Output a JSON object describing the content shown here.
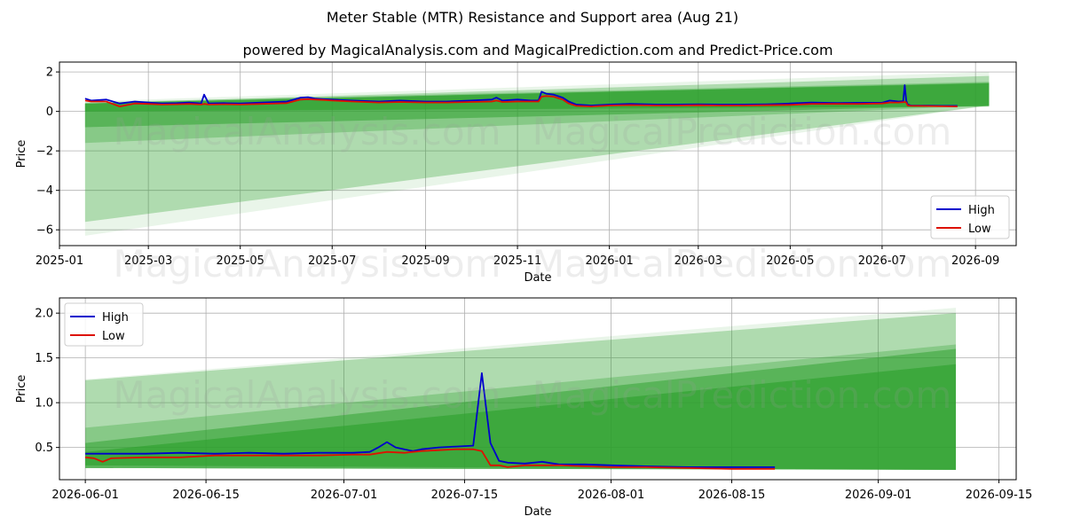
{
  "title": "Meter Stable (MTR) Resistance and Support area (Aug 21)",
  "subtitle": "powered by MagicalAnalysis.com and MagicalPrediction.com and Predict-Price.com",
  "watermarks": [
    "MagicalAnalysis.com",
    "MagicalPrediction.com"
  ],
  "colors": {
    "high": "#0000cc",
    "low": "#dd1100",
    "band": "#2ca02c",
    "grid": "#b0b0b0"
  },
  "chart_data": [
    {
      "type": "line",
      "xlabel": "Date",
      "ylabel": "Price",
      "x_ticks": [
        "2025-01",
        "2025-03",
        "2025-05",
        "2025-07",
        "2025-09",
        "2025-11",
        "2026-01",
        "2026-03",
        "2026-05",
        "2026-07",
        "2026-09"
      ],
      "y_ticks": [
        "−6",
        "−4",
        "−2",
        "0",
        "2"
      ],
      "ylim": [
        -6.8,
        2.5
      ],
      "xlim": [
        "2025-01-01",
        "2026-09-28"
      ],
      "legend": {
        "position": "lower-right",
        "entries": [
          "High",
          "Low"
        ]
      },
      "grid": true,
      "bands": [
        {
          "start": "2025-01-18",
          "end": "2026-09-10",
          "y0_start": 0.5,
          "y1_start": -6.3,
          "y0_end": 2.0,
          "y1_end": 0.3
        },
        {
          "start": "2025-01-18",
          "end": "2026-09-10",
          "y0_start": 0.4,
          "y1_start": -5.6,
          "y0_end": 1.8,
          "y1_end": 0.3
        },
        {
          "start": "2025-01-18",
          "end": "2026-09-10",
          "y0_start": 0.45,
          "y1_start": -1.6,
          "y0_end": 1.5,
          "y1_end": 0.3
        },
        {
          "start": "2025-01-18",
          "end": "2026-09-10",
          "y0_start": 0.4,
          "y1_start": -0.8,
          "y0_end": 1.45,
          "y1_end": 0.3
        },
        {
          "start": "2025-01-18",
          "end": "2026-09-10",
          "y0_start": 0.4,
          "y1_start": 0.0,
          "y0_end": 1.42,
          "y1_end": 0.25
        }
      ],
      "series": [
        {
          "name": "High",
          "x": [
            "2025-01-18",
            "2025-01-22",
            "2025-02-01",
            "2025-02-10",
            "2025-02-20",
            "2025-03-01",
            "2025-03-10",
            "2025-03-20",
            "2025-03-28",
            "2025-04-05",
            "2025-04-07",
            "2025-04-10",
            "2025-04-20",
            "2025-05-01",
            "2025-05-15",
            "2025-06-01",
            "2025-06-10",
            "2025-06-15",
            "2025-06-20",
            "2025-06-25",
            "2025-07-01",
            "2025-07-15",
            "2025-08-01",
            "2025-08-15",
            "2025-09-01",
            "2025-09-15",
            "2025-10-01",
            "2025-10-15",
            "2025-10-18",
            "2025-10-22",
            "2025-11-01",
            "2025-11-10",
            "2025-11-15",
            "2025-11-17",
            "2025-11-20",
            "2025-11-25",
            "2025-12-01",
            "2025-12-05",
            "2025-12-10",
            "2025-12-20",
            "2026-01-01",
            "2026-01-15",
            "2026-02-01",
            "2026-02-15",
            "2026-03-01",
            "2026-03-15",
            "2026-04-01",
            "2026-04-15",
            "2026-05-01",
            "2026-05-15",
            "2026-06-01",
            "2026-06-15",
            "2026-07-01",
            "2026-07-06",
            "2026-07-12",
            "2026-07-15",
            "2026-07-16",
            "2026-07-17",
            "2026-07-18",
            "2026-07-20",
            "2026-08-01",
            "2026-08-10",
            "2026-08-20"
          ],
          "y": [
            0.65,
            0.55,
            0.6,
            0.4,
            0.5,
            0.45,
            0.4,
            0.42,
            0.45,
            0.4,
            0.85,
            0.4,
            0.42,
            0.4,
            0.45,
            0.5,
            0.7,
            0.72,
            0.65,
            0.62,
            0.6,
            0.55,
            0.5,
            0.55,
            0.5,
            0.5,
            0.55,
            0.6,
            0.7,
            0.55,
            0.6,
            0.55,
            0.55,
            1.0,
            0.9,
            0.85,
            0.7,
            0.5,
            0.35,
            0.3,
            0.35,
            0.38,
            0.35,
            0.35,
            0.36,
            0.35,
            0.35,
            0.36,
            0.4,
            0.45,
            0.43,
            0.44,
            0.44,
            0.55,
            0.5,
            0.52,
            1.33,
            0.55,
            0.35,
            0.3,
            0.29,
            0.28,
            0.28
          ]
        },
        {
          "name": "Low",
          "x": [
            "2025-01-18",
            "2025-01-22",
            "2025-02-01",
            "2025-02-10",
            "2025-02-20",
            "2025-03-01",
            "2025-03-10",
            "2025-03-20",
            "2025-03-28",
            "2025-04-05",
            "2025-04-07",
            "2025-04-10",
            "2025-04-20",
            "2025-05-01",
            "2025-05-15",
            "2025-06-01",
            "2025-06-10",
            "2025-06-15",
            "2025-06-20",
            "2025-06-25",
            "2025-07-01",
            "2025-07-15",
            "2025-08-01",
            "2025-08-15",
            "2025-09-01",
            "2025-09-15",
            "2025-10-01",
            "2025-10-15",
            "2025-10-18",
            "2025-10-22",
            "2025-11-01",
            "2025-11-10",
            "2025-11-15",
            "2025-11-17",
            "2025-11-20",
            "2025-11-25",
            "2025-12-01",
            "2025-12-05",
            "2025-12-10",
            "2025-12-20",
            "2026-01-01",
            "2026-01-15",
            "2026-02-01",
            "2026-02-15",
            "2026-03-01",
            "2026-03-15",
            "2026-04-01",
            "2026-04-15",
            "2026-05-01",
            "2026-05-15",
            "2026-06-01",
            "2026-06-15",
            "2026-07-01",
            "2026-07-06",
            "2026-07-12",
            "2026-07-15",
            "2026-07-16",
            "2026-07-17",
            "2026-07-18",
            "2026-07-20",
            "2026-08-01",
            "2026-08-10",
            "2026-08-20"
          ],
          "y": [
            0.55,
            0.5,
            0.5,
            0.25,
            0.4,
            0.38,
            0.35,
            0.36,
            0.38,
            0.35,
            0.38,
            0.35,
            0.36,
            0.35,
            0.38,
            0.42,
            0.6,
            0.62,
            0.6,
            0.58,
            0.55,
            0.5,
            0.45,
            0.48,
            0.45,
            0.45,
            0.48,
            0.5,
            0.55,
            0.48,
            0.5,
            0.5,
            0.5,
            0.75,
            0.78,
            0.75,
            0.6,
            0.4,
            0.28,
            0.25,
            0.3,
            0.32,
            0.3,
            0.3,
            0.31,
            0.3,
            0.3,
            0.31,
            0.33,
            0.38,
            0.38,
            0.38,
            0.4,
            0.45,
            0.45,
            0.47,
            0.48,
            0.45,
            0.3,
            0.28,
            0.27,
            0.26,
            0.25
          ]
        }
      ]
    },
    {
      "type": "line",
      "xlabel": "Date",
      "ylabel": "Price",
      "x_ticks": [
        "2026-06-01",
        "2026-06-15",
        "2026-07-01",
        "2026-07-15",
        "2026-08-01",
        "2026-08-15",
        "2026-09-01",
        "2026-09-15"
      ],
      "y_ticks": [
        "0.5",
        "1.0",
        "1.5",
        "2.0"
      ],
      "ylim": [
        0.14,
        2.17
      ],
      "xlim": [
        "2026-05-29",
        "2026-09-17"
      ],
      "legend": {
        "position": "upper-left",
        "entries": [
          "High",
          "Low"
        ]
      },
      "grid": true,
      "bands": [
        {
          "start": "2026-06-01",
          "end": "2026-09-10",
          "y0_start": 1.26,
          "y1_start": 0.27,
          "y0_end": 2.06,
          "y1_end": 0.25
        },
        {
          "start": "2026-06-01",
          "end": "2026-09-10",
          "y0_start": 1.25,
          "y1_start": 0.27,
          "y0_end": 2.0,
          "y1_end": 0.25
        },
        {
          "start": "2026-06-01",
          "end": "2026-09-10",
          "y0_start": 0.72,
          "y1_start": 0.27,
          "y0_end": 1.65,
          "y1_end": 0.25
        },
        {
          "start": "2026-06-01",
          "end": "2026-09-10",
          "y0_start": 0.55,
          "y1_start": 0.27,
          "y0_end": 1.6,
          "y1_end": 0.25
        },
        {
          "start": "2026-06-01",
          "end": "2026-09-10",
          "y0_start": 0.45,
          "y1_start": 0.3,
          "y0_end": 1.43,
          "y1_end": 0.25
        }
      ],
      "series": [
        {
          "name": "High",
          "x": [
            "2026-06-01",
            "2026-06-04",
            "2026-06-08",
            "2026-06-12",
            "2026-06-16",
            "2026-06-20",
            "2026-06-24",
            "2026-06-28",
            "2026-07-02",
            "2026-07-04",
            "2026-07-05",
            "2026-07-06",
            "2026-07-07",
            "2026-07-08",
            "2026-07-09",
            "2026-07-10",
            "2026-07-12",
            "2026-07-14",
            "2026-07-16",
            "2026-07-17",
            "2026-07-18",
            "2026-07-19",
            "2026-07-20",
            "2026-07-22",
            "2026-07-24",
            "2026-07-26",
            "2026-07-29",
            "2026-08-01",
            "2026-08-05",
            "2026-08-10",
            "2026-08-15",
            "2026-08-20"
          ],
          "y": [
            0.43,
            0.43,
            0.43,
            0.44,
            0.43,
            0.44,
            0.43,
            0.44,
            0.44,
            0.45,
            0.5,
            0.56,
            0.5,
            0.48,
            0.46,
            0.48,
            0.5,
            0.51,
            0.52,
            1.33,
            0.55,
            0.35,
            0.33,
            0.32,
            0.34,
            0.31,
            0.31,
            0.3,
            0.29,
            0.28,
            0.28,
            0.28
          ]
        },
        {
          "name": "Low",
          "x": [
            "2026-06-01",
            "2026-06-02",
            "2026-06-03",
            "2026-06-04",
            "2026-06-08",
            "2026-06-12",
            "2026-06-16",
            "2026-06-20",
            "2026-06-24",
            "2026-06-28",
            "2026-07-02",
            "2026-07-04",
            "2026-07-06",
            "2026-07-08",
            "2026-07-10",
            "2026-07-12",
            "2026-07-14",
            "2026-07-16",
            "2026-07-17",
            "2026-07-18",
            "2026-07-19",
            "2026-07-20",
            "2026-07-22",
            "2026-07-24",
            "2026-07-26",
            "2026-07-29",
            "2026-08-01",
            "2026-08-05",
            "2026-08-10",
            "2026-08-15",
            "2026-08-20"
          ],
          "y": [
            0.39,
            0.38,
            0.34,
            0.38,
            0.39,
            0.39,
            0.41,
            0.41,
            0.41,
            0.41,
            0.42,
            0.42,
            0.45,
            0.44,
            0.46,
            0.47,
            0.48,
            0.48,
            0.46,
            0.3,
            0.3,
            0.28,
            0.3,
            0.3,
            0.3,
            0.29,
            0.28,
            0.28,
            0.27,
            0.26,
            0.26
          ]
        }
      ]
    }
  ]
}
